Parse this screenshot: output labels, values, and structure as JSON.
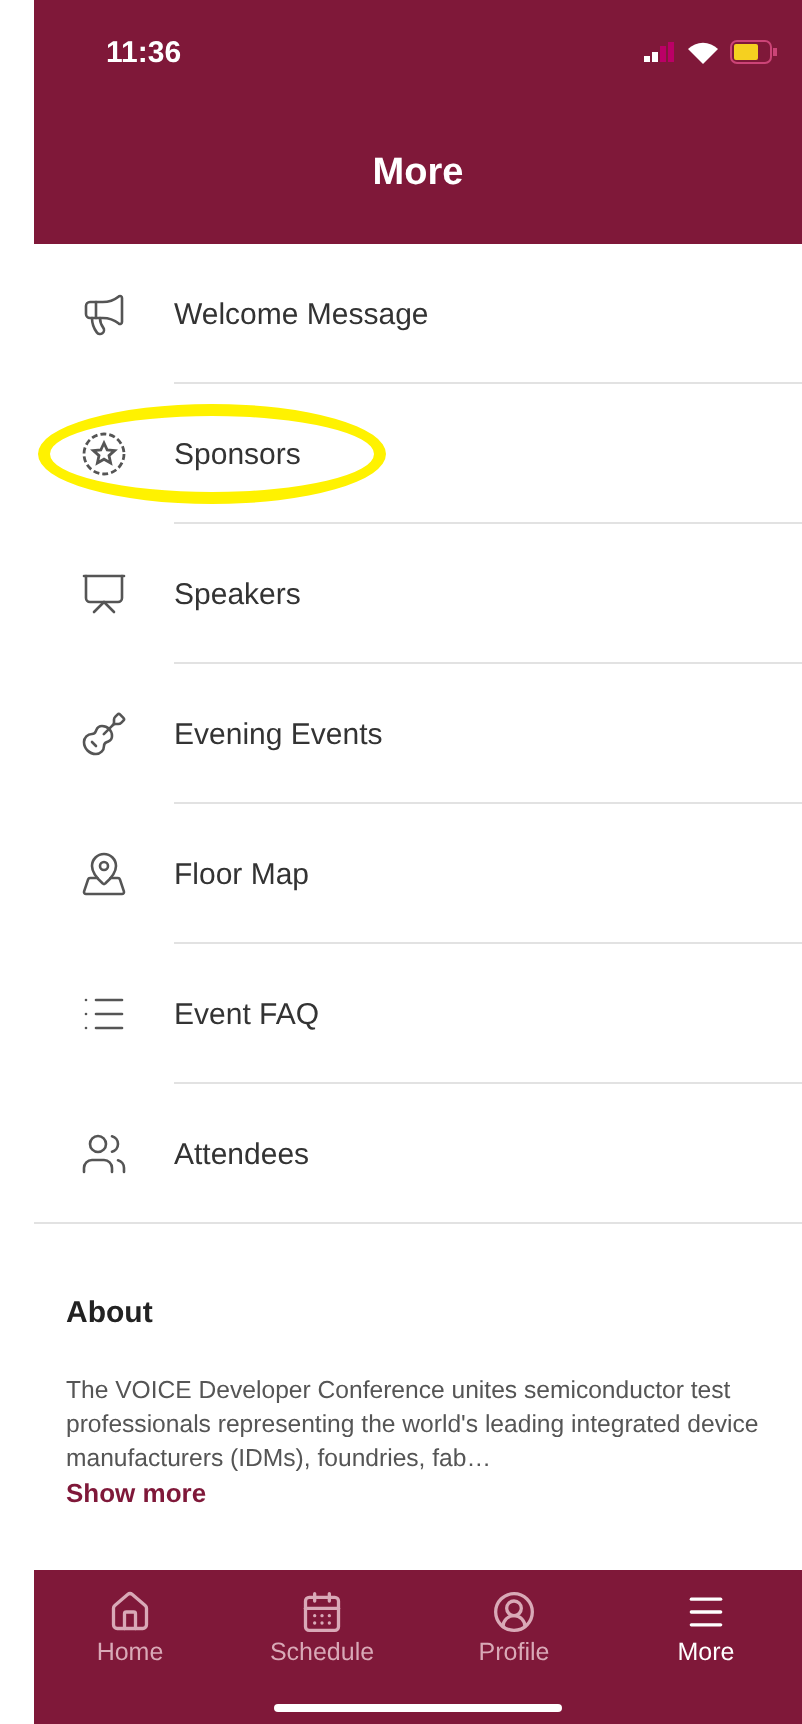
{
  "status_bar": {
    "time": "11:36"
  },
  "header": {
    "title": "More"
  },
  "menu": [
    {
      "kind": "megaphone",
      "label": "Welcome Message",
      "highlighted": false
    },
    {
      "kind": "badge",
      "label": "Sponsors",
      "highlighted": true
    },
    {
      "kind": "speaker",
      "label": "Speakers",
      "highlighted": false
    },
    {
      "kind": "guitar",
      "label": "Evening Events",
      "highlighted": false
    },
    {
      "kind": "map",
      "label": "Floor Map",
      "highlighted": false
    },
    {
      "kind": "list",
      "label": "Event FAQ",
      "highlighted": false
    },
    {
      "kind": "people",
      "label": "Attendees",
      "highlighted": false
    }
  ],
  "about": {
    "title": "About",
    "text": "The VOICE Developer Conference unites semiconductor test professionals representing the world's leading integrated device manufacturers (IDMs), foundries, fab…",
    "link": "Show more"
  },
  "tab_bar": [
    {
      "kind": "home",
      "label": "Home",
      "selected": false
    },
    {
      "kind": "calendar",
      "label": "Schedule",
      "selected": false
    },
    {
      "kind": "profile",
      "label": "Profile",
      "selected": false
    },
    {
      "kind": "menu",
      "label": "More",
      "selected": true
    }
  ]
}
